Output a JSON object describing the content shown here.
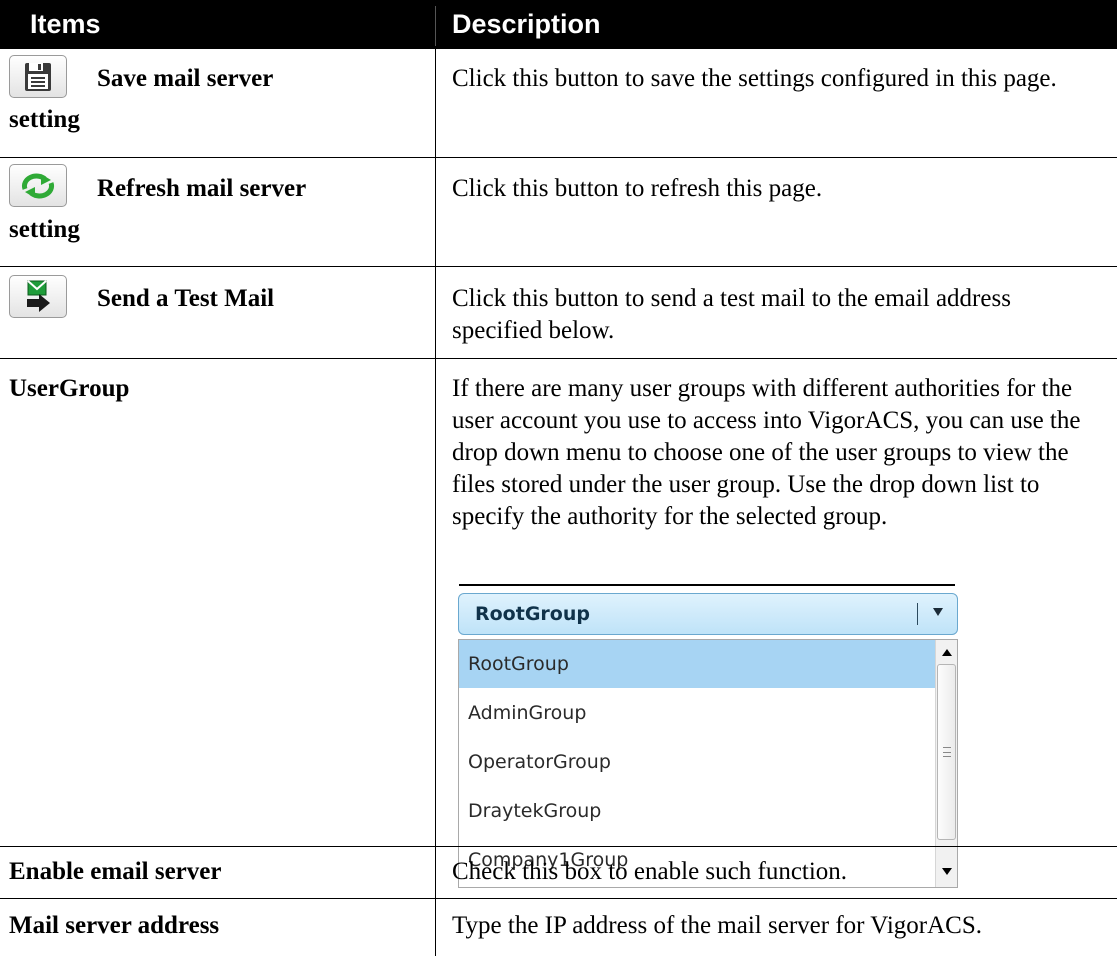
{
  "table": {
    "headers": {
      "items": "Items",
      "description": "Description"
    },
    "rows": [
      {
        "icon": "save-icon",
        "label_line1": "Save mail server",
        "label_line2": "setting",
        "description": "Click this button to save the settings configured in this page."
      },
      {
        "icon": "refresh-icon",
        "label_line1": "Refresh mail server",
        "label_line2": "setting",
        "description": "Click this button to refresh this page."
      },
      {
        "icon": "send-mail-icon",
        "label_line1": "Send a Test Mail",
        "description": "Click this button to send a test mail to the email address specified below."
      },
      {
        "label_line1": "UserGroup",
        "description": "If there are many user groups with different authorities for the user account you use to access into VigorACS, you can use the drop down menu to choose one of the user groups to view the files stored under the user group. Use the drop down list to specify the authority for the selected group."
      },
      {
        "label_line1": "Enable email server",
        "description": "Check this box to enable such function."
      },
      {
        "label_line1": "Mail server address",
        "description": "Type the IP address of the mail server for VigorACS."
      }
    ]
  },
  "usergroup_dropdown": {
    "selected": "RootGroup",
    "options": [
      "RootGroup",
      "AdminGroup",
      "OperatorGroup",
      "DraytekGroup",
      "Company1Group"
    ],
    "highlighted_option": "RootGroup"
  },
  "colors": {
    "header_bg": "#000000",
    "header_text": "#ffffff",
    "dropdown_selected_bg": "#a7d4f3",
    "save_icon_gray": "#3a3a3a",
    "refresh_icon_green": "#2faa36",
    "send_icon_green": "#1f9c3a"
  }
}
